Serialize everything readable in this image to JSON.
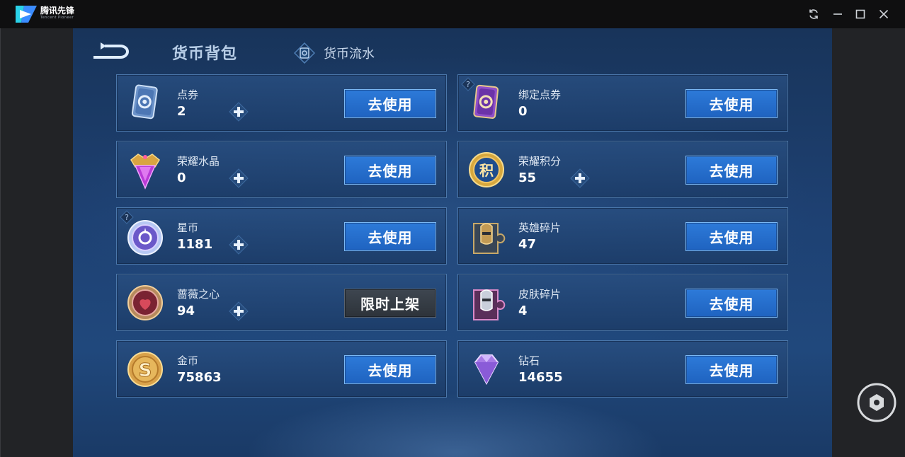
{
  "titlebar": {
    "brand": "腾讯先锋",
    "brand_sub": "Tencent Pioneer",
    "buttons": [
      "refresh-icon",
      "minimize-icon",
      "maximize-icon",
      "close-icon"
    ]
  },
  "header": {
    "active_tab": "货币背包",
    "secondary_tab": "货币流水"
  },
  "colors": {
    "accent": "#2d7ad9",
    "card_border": "#4b77aa",
    "background": "#1e4173"
  },
  "currencies": [
    {
      "name": "点券",
      "amount": "2",
      "button": "去使用",
      "has_plus": true,
      "has_help": false,
      "icon": "ticket-card-icon"
    },
    {
      "name": "绑定点券",
      "amount": "0",
      "button": "去使用",
      "has_plus": false,
      "has_help": true,
      "icon": "bound-ticket-card-icon"
    },
    {
      "name": "荣耀水晶",
      "amount": "0",
      "button": "去使用",
      "has_plus": true,
      "has_help": false,
      "icon": "glory-crystal-icon"
    },
    {
      "name": "荣耀积分",
      "amount": "55",
      "button": "去使用",
      "has_plus": true,
      "has_help": false,
      "icon": "glory-points-icon",
      "icon_text": "积"
    },
    {
      "name": "星币",
      "amount": "1181",
      "button": "去使用",
      "has_plus": true,
      "has_help": true,
      "icon": "star-coin-icon"
    },
    {
      "name": "英雄碎片",
      "amount": "47",
      "button": "去使用",
      "has_plus": false,
      "has_help": false,
      "icon": "hero-fragment-icon"
    },
    {
      "name": "蔷薇之心",
      "amount": "94",
      "button": "限时上架",
      "has_plus": true,
      "has_help": false,
      "icon": "rose-heart-icon"
    },
    {
      "name": "皮肤碎片",
      "amount": "4",
      "button": "去使用",
      "has_plus": false,
      "has_help": false,
      "icon": "skin-fragment-icon"
    },
    {
      "name": "金币",
      "amount": "75863",
      "button": "去使用",
      "has_plus": false,
      "has_help": false,
      "icon": "gold-coin-icon",
      "icon_text": "S"
    },
    {
      "name": "钻石",
      "amount": "14655",
      "button": "去使用",
      "has_plus": false,
      "has_help": false,
      "icon": "diamond-icon"
    }
  ]
}
